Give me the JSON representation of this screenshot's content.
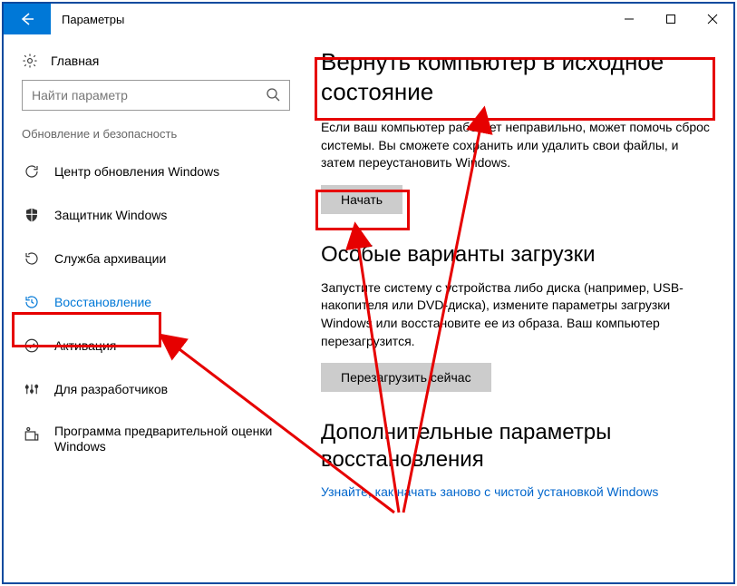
{
  "window": {
    "title": "Параметры"
  },
  "sidebar": {
    "home": "Главная",
    "search_placeholder": "Найти параметр",
    "group": "Обновление и безопасность",
    "items": [
      {
        "label": "Центр обновления Windows"
      },
      {
        "label": "Защитник Windows"
      },
      {
        "label": "Служба архивации"
      },
      {
        "label": "Восстановление"
      },
      {
        "label": "Активация"
      },
      {
        "label": "Для разработчиков"
      },
      {
        "label": "Программа предварительной оценки Windows"
      }
    ]
  },
  "content": {
    "reset": {
      "title": "Вернуть компьютер в исходное состояние",
      "desc": "Если ваш компьютер работает неправильно, может помочь сброс системы. Вы сможете сохранить или удалить свои файлы, и затем переустановить Windows.",
      "button": "Начать"
    },
    "advboot": {
      "title": "Особые варианты загрузки",
      "desc": "Запустите систему с устройства либо диска (например, USB-накопителя или DVD-диска), измените параметры загрузки Windows или восстановите ее из образа. Ваш компьютер перезагрузится.",
      "button": "Перезагрузить сейчас"
    },
    "more": {
      "title": "Дополнительные параметры восстановления",
      "link": "Узнайте, как начать заново с чистой установкой Windows"
    }
  }
}
